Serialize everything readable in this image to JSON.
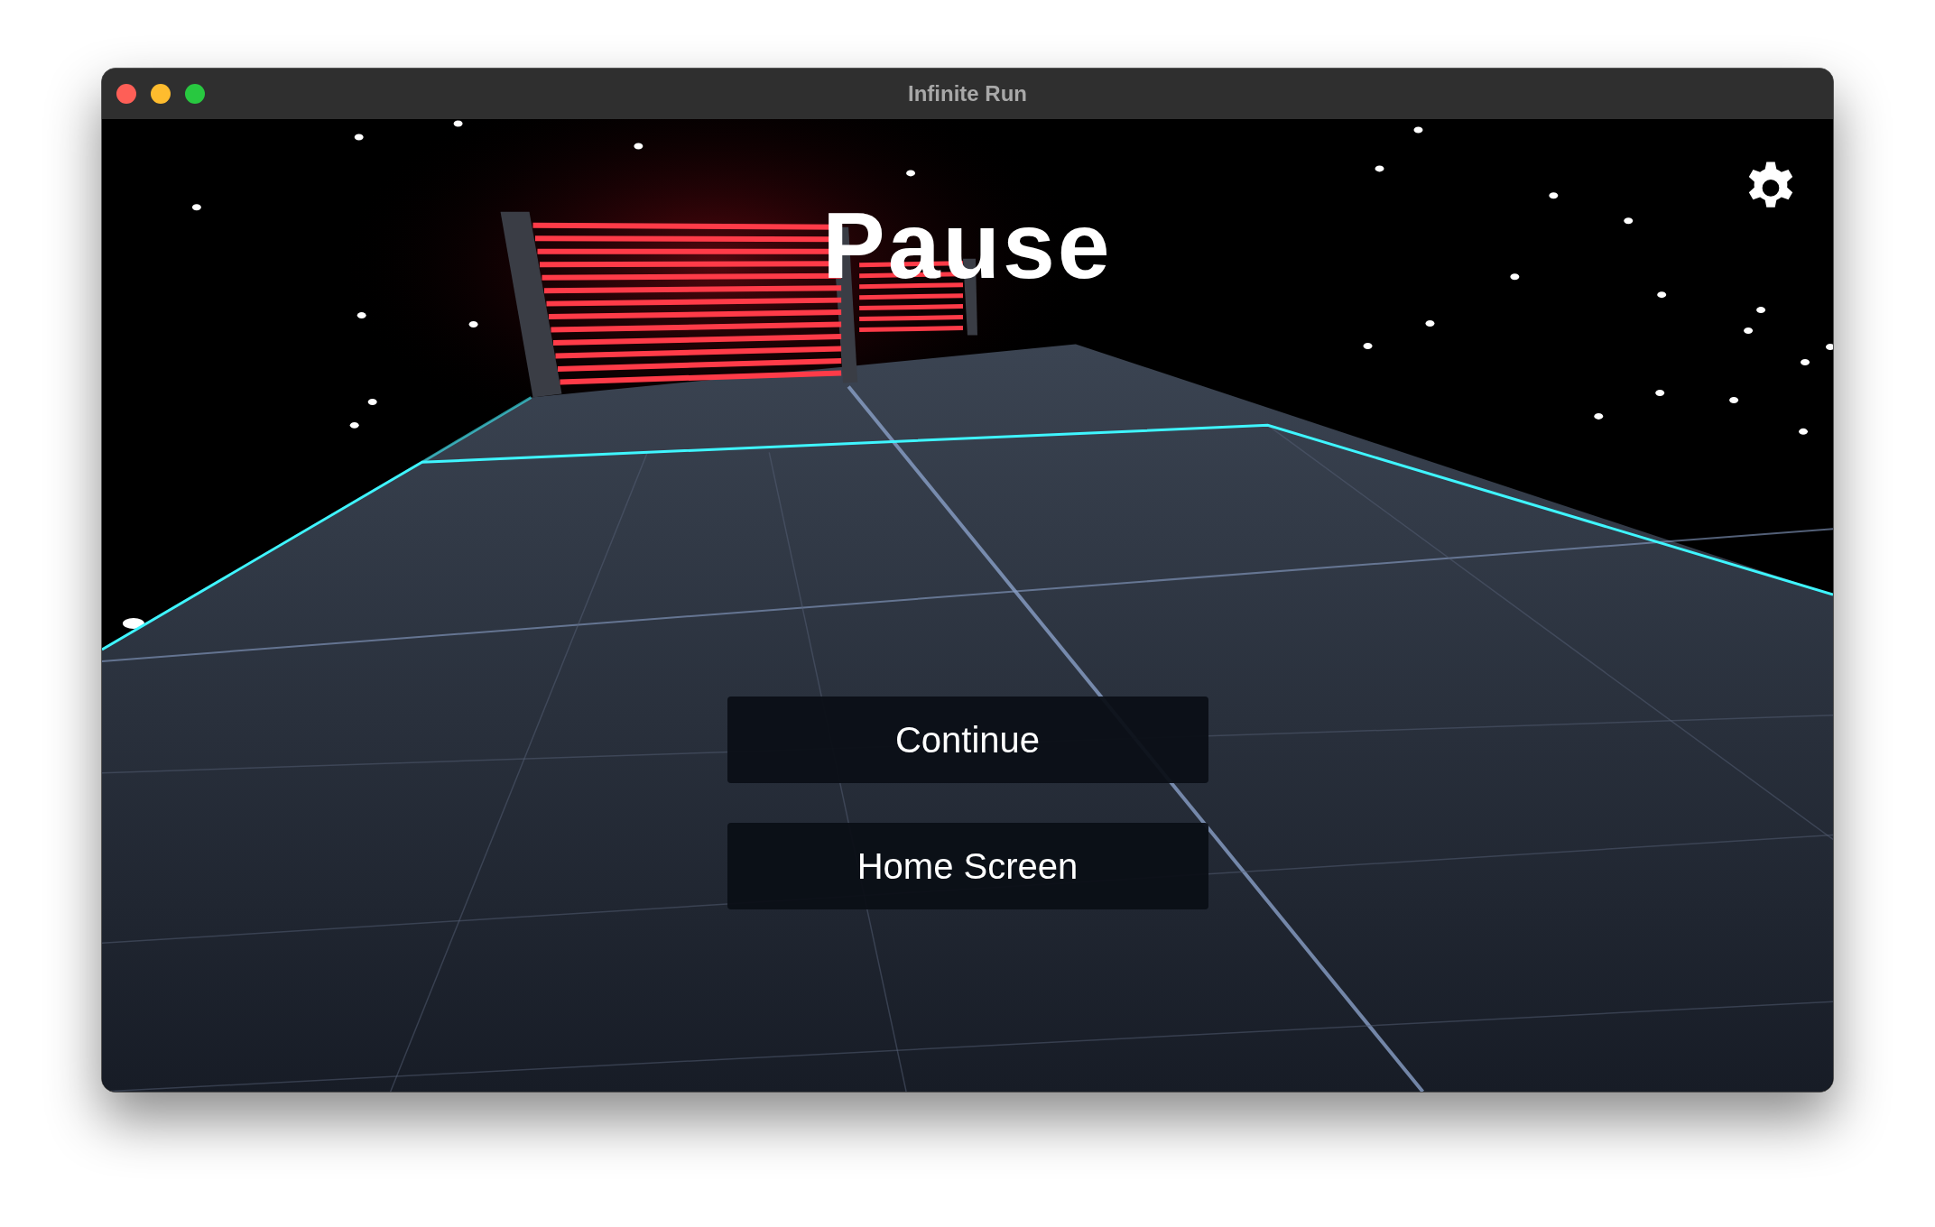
{
  "window": {
    "title": "Infinite Run"
  },
  "menu": {
    "title": "Pause",
    "buttons": [
      {
        "label": "Continue"
      },
      {
        "label": "Home Screen"
      }
    ]
  }
}
